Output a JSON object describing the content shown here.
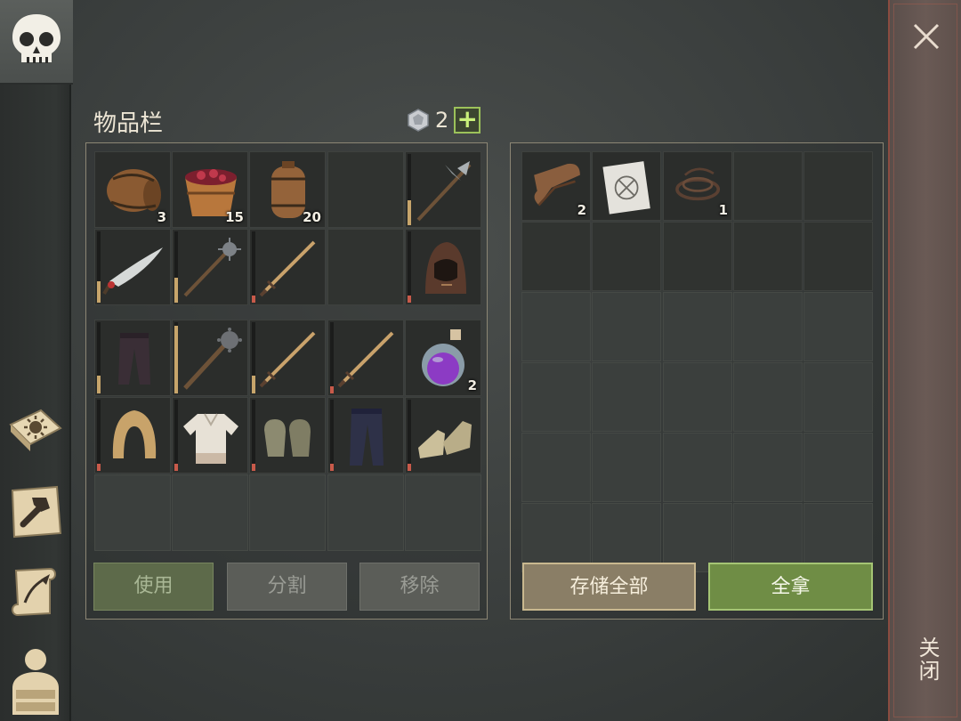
{
  "inventory": {
    "title": "物品栏",
    "gem_count": "2",
    "gem_plus": "+",
    "slots": [
      {
        "item": "barrel-icon",
        "qty": "3"
      },
      {
        "item": "berry-bucket-icon",
        "qty": "15"
      },
      {
        "item": "keg-icon",
        "qty": "20"
      },
      {
        "item": "",
        "qty": ""
      },
      {
        "item": "halberd-icon",
        "qty": "",
        "durability": 0.35,
        "bar_color": "#c7a56b"
      },
      {
        "item": "scimitar-icon",
        "qty": "",
        "durability": 0.3,
        "bar_color": "#c7a56b"
      },
      {
        "item": "morningstar-icon",
        "qty": "",
        "durability": 0.35,
        "bar_color": "#c7a56b"
      },
      {
        "item": "sword-icon",
        "qty": "",
        "durability": 0.1,
        "bar_color": "#c85a4a"
      },
      {
        "item": "",
        "qty": ""
      },
      {
        "item": "hood-icon",
        "qty": "",
        "durability": 0.1,
        "bar_color": "#c85a4a"
      },
      {
        "item": "pants-icon",
        "qty": "",
        "durability": 0.25,
        "bar_color": "#c7a56b"
      },
      {
        "item": "mace-icon",
        "qty": "",
        "durability": 0.95,
        "bar_color": "#c7a56b"
      },
      {
        "item": "sword-icon",
        "qty": "",
        "durability": 0.25,
        "bar_color": "#c7a56b"
      },
      {
        "item": "sword-icon",
        "qty": "",
        "durability": 0.1,
        "bar_color": "#c85a4a"
      },
      {
        "item": "potion-icon",
        "qty": "2"
      },
      {
        "item": "leather-hood-icon",
        "qty": "",
        "durability": 0.1,
        "bar_color": "#c85a4a"
      },
      {
        "item": "shirt-icon",
        "qty": "",
        "durability": 0.1,
        "bar_color": "#c85a4a"
      },
      {
        "item": "gloves-icon",
        "qty": "",
        "durability": 0.1,
        "bar_color": "#c85a4a"
      },
      {
        "item": "cloth-pants-icon",
        "qty": "",
        "durability": 0.1,
        "bar_color": "#c85a4a"
      },
      {
        "item": "boots-icon",
        "qty": "",
        "durability": 0.1,
        "bar_color": "#c85a4a"
      }
    ],
    "buttons": {
      "use": "使用",
      "split": "分割",
      "remove": "移除"
    }
  },
  "loot": {
    "slots": [
      {
        "item": "leather-scroll-icon",
        "qty": "2"
      },
      {
        "item": "blueprint-icon",
        "qty": ""
      },
      {
        "item": "rope-icon",
        "qty": "1"
      }
    ],
    "buttons": {
      "store_all": "存储全部",
      "take_all": "全拿"
    }
  },
  "close_label": "关闭",
  "rail": [
    "skull-icon",
    "sun-book-icon",
    "crafting-hammer-icon",
    "quest-scroll-icon",
    "character-icon"
  ]
}
